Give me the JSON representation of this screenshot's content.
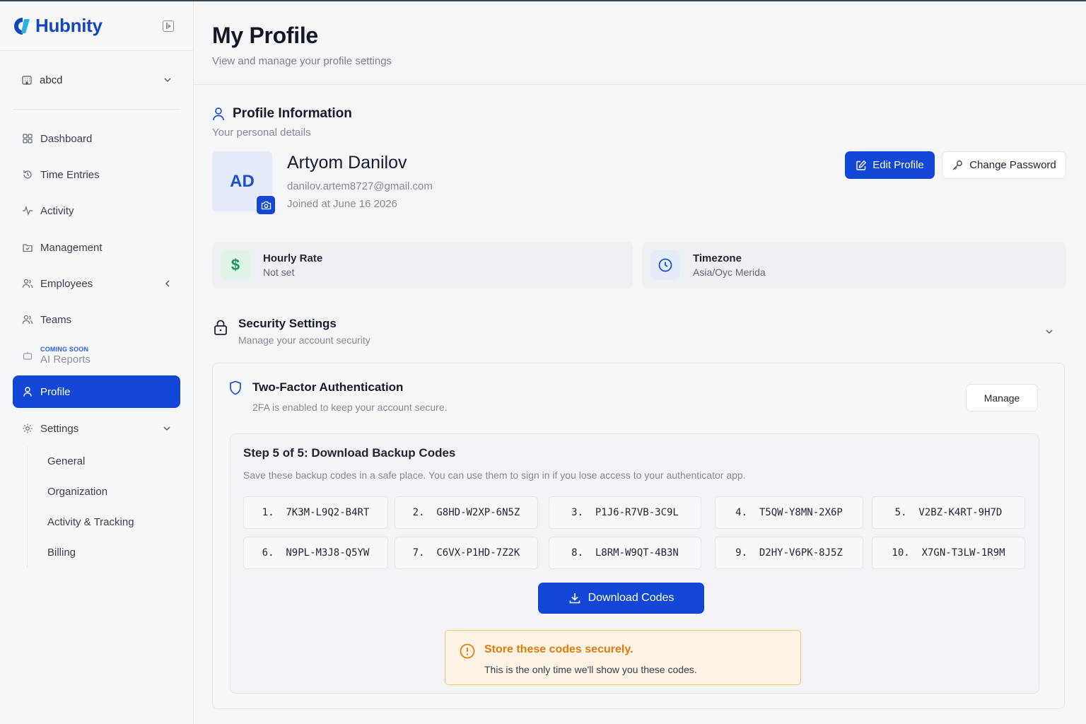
{
  "app": {
    "name": "Hubnity"
  },
  "sidebar": {
    "workspace": "abcd",
    "items": [
      {
        "label": "Dashboard"
      },
      {
        "label": "Time Entries"
      },
      {
        "label": "Activity"
      },
      {
        "label": "Management"
      },
      {
        "label": "Employees"
      },
      {
        "label": "Teams"
      },
      {
        "label": "AI Reports",
        "badge": "COMING SOON"
      },
      {
        "label": "Profile"
      },
      {
        "label": "Settings"
      }
    ],
    "settings_sub": [
      {
        "label": "General"
      },
      {
        "label": "Organization"
      },
      {
        "label": "Activity & Tracking"
      },
      {
        "label": "Billing"
      }
    ]
  },
  "page": {
    "title": "My Profile",
    "subtitle": "View and manage your profile settings"
  },
  "profile": {
    "section_title": "Profile Information",
    "section_sub": "Your personal details",
    "initials": "AD",
    "name": "Artyom Danilov",
    "email": "danilov.artem8727@gmail.com",
    "joined": "Joined at June 16 2026",
    "edit_label": "Edit Profile",
    "change_password_label": "Change Password",
    "hourly_rate_label": "Hourly Rate",
    "hourly_rate_value": "Not set",
    "timezone_label": "Timezone",
    "timezone_value": "Asia/Oyc Merida"
  },
  "security": {
    "title": "Security Settings",
    "sub": "Manage your account security",
    "tfa_title": "Two-Factor Authentication",
    "tfa_sub": "2FA is enabled to keep your account secure.",
    "manage_label": "Manage",
    "step_title": "Step 5 of 5: Download Backup Codes",
    "step_desc": "Save these backup codes in a safe place. You can use them to sign in if you lose access to your authenticator app.",
    "codes": [
      "1.  7K3M-L9Q2-B4RT",
      "2.  G8HD-W2XP-6N5Z",
      "3.  P1J6-R7VB-3C9L",
      "4.  T5QW-Y8MN-2X6P",
      "5.  V2BZ-K4RT-9H7D",
      "6.  N9PL-M3J8-Q5YW",
      "7.  C6VX-P1HD-7Z2K",
      "8.  L8RM-W9QT-4B3N",
      "9.  D2HY-V6PK-8J5Z",
      "10.  X7GN-T3LW-1R9M"
    ],
    "download_label": "Download Codes",
    "warn_title": "Store these codes securely.",
    "warn_text": "This is the only time we'll show you these codes."
  },
  "colors": {
    "accent": "#1247d6",
    "warning": "#e07b0c",
    "success": "#1a9a57"
  }
}
